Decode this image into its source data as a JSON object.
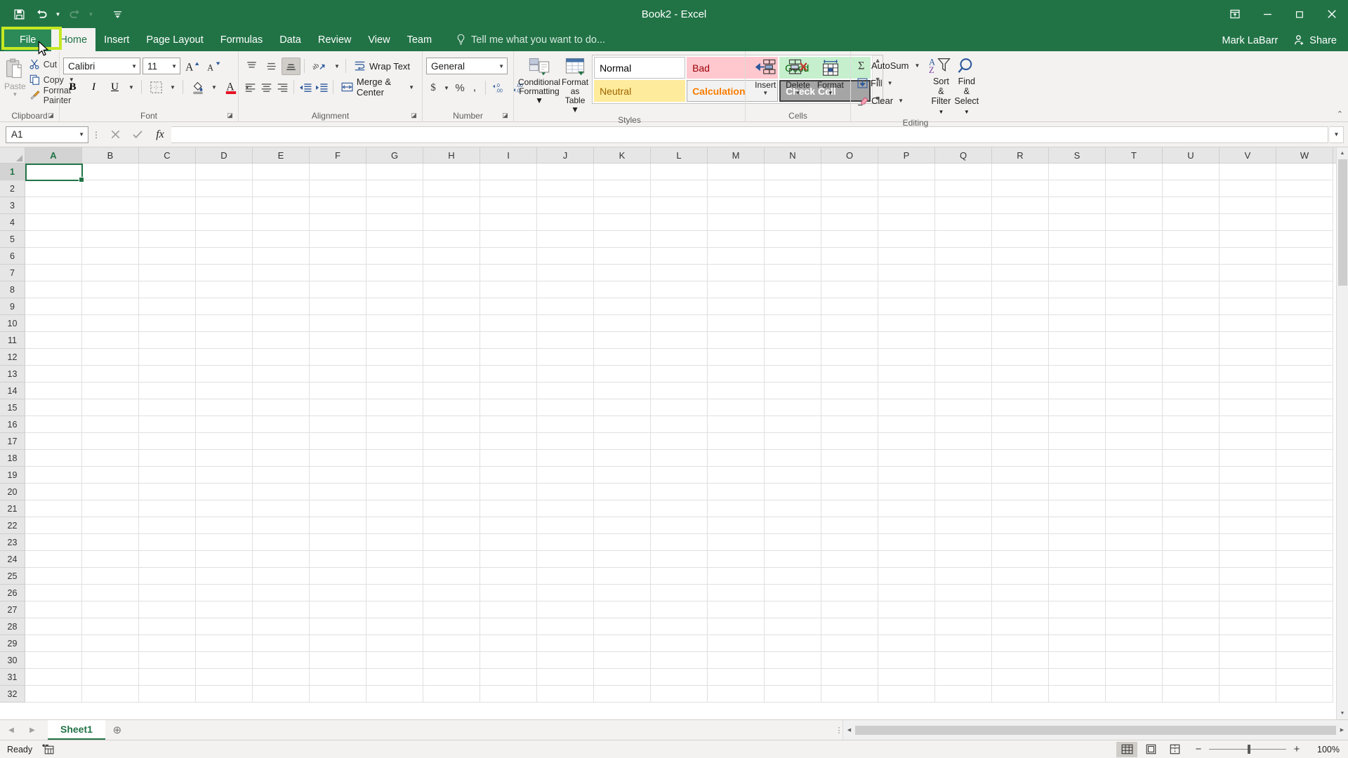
{
  "window": {
    "title": "Book2 - Excel",
    "user_name": "Mark LaBarr",
    "share_label": "Share",
    "quick_access": [
      {
        "name": "save-icon",
        "label": "Save",
        "disabled": false
      },
      {
        "name": "undo-icon",
        "label": "Undo",
        "disabled": false
      },
      {
        "name": "redo-icon",
        "label": "Redo",
        "disabled": true
      },
      {
        "name": "customize-qat-icon",
        "label": "Customize Quick Access Toolbar",
        "disabled": false
      }
    ],
    "controls": {
      "ribbon_display": "Ribbon Display Options",
      "minimize": "Minimize",
      "restore": "Restore Down",
      "close": "Close"
    }
  },
  "tabs": {
    "file": "File",
    "items": [
      "Home",
      "Insert",
      "Page Layout",
      "Formulas",
      "Data",
      "Review",
      "View",
      "Team"
    ],
    "active": "Home",
    "tell_me": "Tell me what you want to do...",
    "highlight_color": "#c5e821"
  },
  "ribbon": {
    "clipboard": {
      "label": "Clipboard",
      "paste": "Paste",
      "cut": "Cut",
      "copy": "Copy",
      "format_painter": "Format Painter"
    },
    "font": {
      "label": "Font",
      "font_name": "Calibri",
      "font_size": "11",
      "grow_font": "Increase Font Size",
      "shrink_font": "Decrease Font Size",
      "bold": "B",
      "italic": "I",
      "underline": "U",
      "borders": "Borders",
      "fill_color": "Fill Color",
      "font_color": "Font Color"
    },
    "alignment": {
      "label": "Alignment",
      "top_align": "Top Align",
      "middle_align": "Middle Align",
      "bottom_align": "Bottom Align",
      "orientation": "Orientation",
      "wrap_text": "Wrap Text",
      "align_left": "Align Left",
      "center": "Center",
      "align_right": "Align Right",
      "decrease_indent": "Decrease Indent",
      "increase_indent": "Increase Indent",
      "merge_center": "Merge & Center"
    },
    "number": {
      "label": "Number",
      "format": "General",
      "accounting": "$",
      "percent": "%",
      "comma": ",",
      "increase_decimal": "Increase Decimal",
      "decrease_decimal": "Decrease Decimal"
    },
    "styles": {
      "label": "Styles",
      "conditional_formatting": "Conditional\nFormatting",
      "conditional_formatting_line1": "Conditional",
      "conditional_formatting_line2": "Formatting",
      "format_as_table_line1": "Format as",
      "format_as_table_line2": "Table",
      "gallery": [
        {
          "name": "Normal",
          "bg": "#ffffff",
          "fg": "#000000",
          "border": "#c0c0c0"
        },
        {
          "name": "Bad",
          "bg": "#ffc7ce",
          "fg": "#9c0006",
          "border": "transparent"
        },
        {
          "name": "Good",
          "bg": "#c6efce",
          "fg": "#006100",
          "border": "transparent"
        },
        {
          "name": "Neutral",
          "bg": "#ffeb9c",
          "fg": "#9c6500",
          "border": "transparent"
        },
        {
          "name": "Calculation",
          "bg": "#f2f2f2",
          "fg": "#fa7d00",
          "border": "#b0b0b0"
        },
        {
          "name": "Check Cell",
          "bg": "#a5a5a5",
          "fg": "#ffffff",
          "border": "#3f3f3f"
        }
      ]
    },
    "cells": {
      "label": "Cells",
      "insert": "Insert",
      "delete": "Delete",
      "format": "Format"
    },
    "editing": {
      "label": "Editing",
      "autosum": "AutoSum",
      "fill": "Fill",
      "clear": "Clear",
      "sort_filter_line1": "Sort &",
      "sort_filter_line2": "Filter",
      "find_select_line1": "Find &",
      "find_select_line2": "Select"
    }
  },
  "formula_bar": {
    "name_box": "A1",
    "cancel": "Cancel",
    "enter": "Enter",
    "insert_function": "fx",
    "value": "",
    "placeholder": ""
  },
  "grid": {
    "columns": [
      "A",
      "B",
      "C",
      "D",
      "E",
      "F",
      "G",
      "H",
      "I",
      "J",
      "K",
      "L",
      "M",
      "N",
      "O",
      "P",
      "Q",
      "R",
      "S",
      "T",
      "U",
      "V",
      "W"
    ],
    "rows": [
      1,
      2,
      3,
      4,
      5,
      6,
      7,
      8,
      9,
      10,
      11,
      12,
      13,
      14,
      15,
      16,
      17,
      18,
      19,
      20,
      21,
      22,
      23,
      24,
      25,
      26,
      27,
      28,
      29,
      30,
      31,
      32
    ],
    "active_cell": "A1",
    "active_column": "A",
    "active_row": 1,
    "selection_color": "#217346"
  },
  "sheet_tabs": {
    "sheets": [
      "Sheet1"
    ],
    "active": "Sheet1",
    "add_label": "New sheet",
    "prev_label": "Previous Sheet",
    "next_label": "Next Sheet"
  },
  "status_bar": {
    "status": "Ready",
    "accessibility_icon": "accessibility-checker-icon",
    "views": [
      {
        "name": "normal-view",
        "selected": true
      },
      {
        "name": "page-layout-view",
        "selected": false
      },
      {
        "name": "page-break-preview",
        "selected": false
      }
    ],
    "zoom_out": "−",
    "zoom_in": "+",
    "zoom": "100%"
  }
}
